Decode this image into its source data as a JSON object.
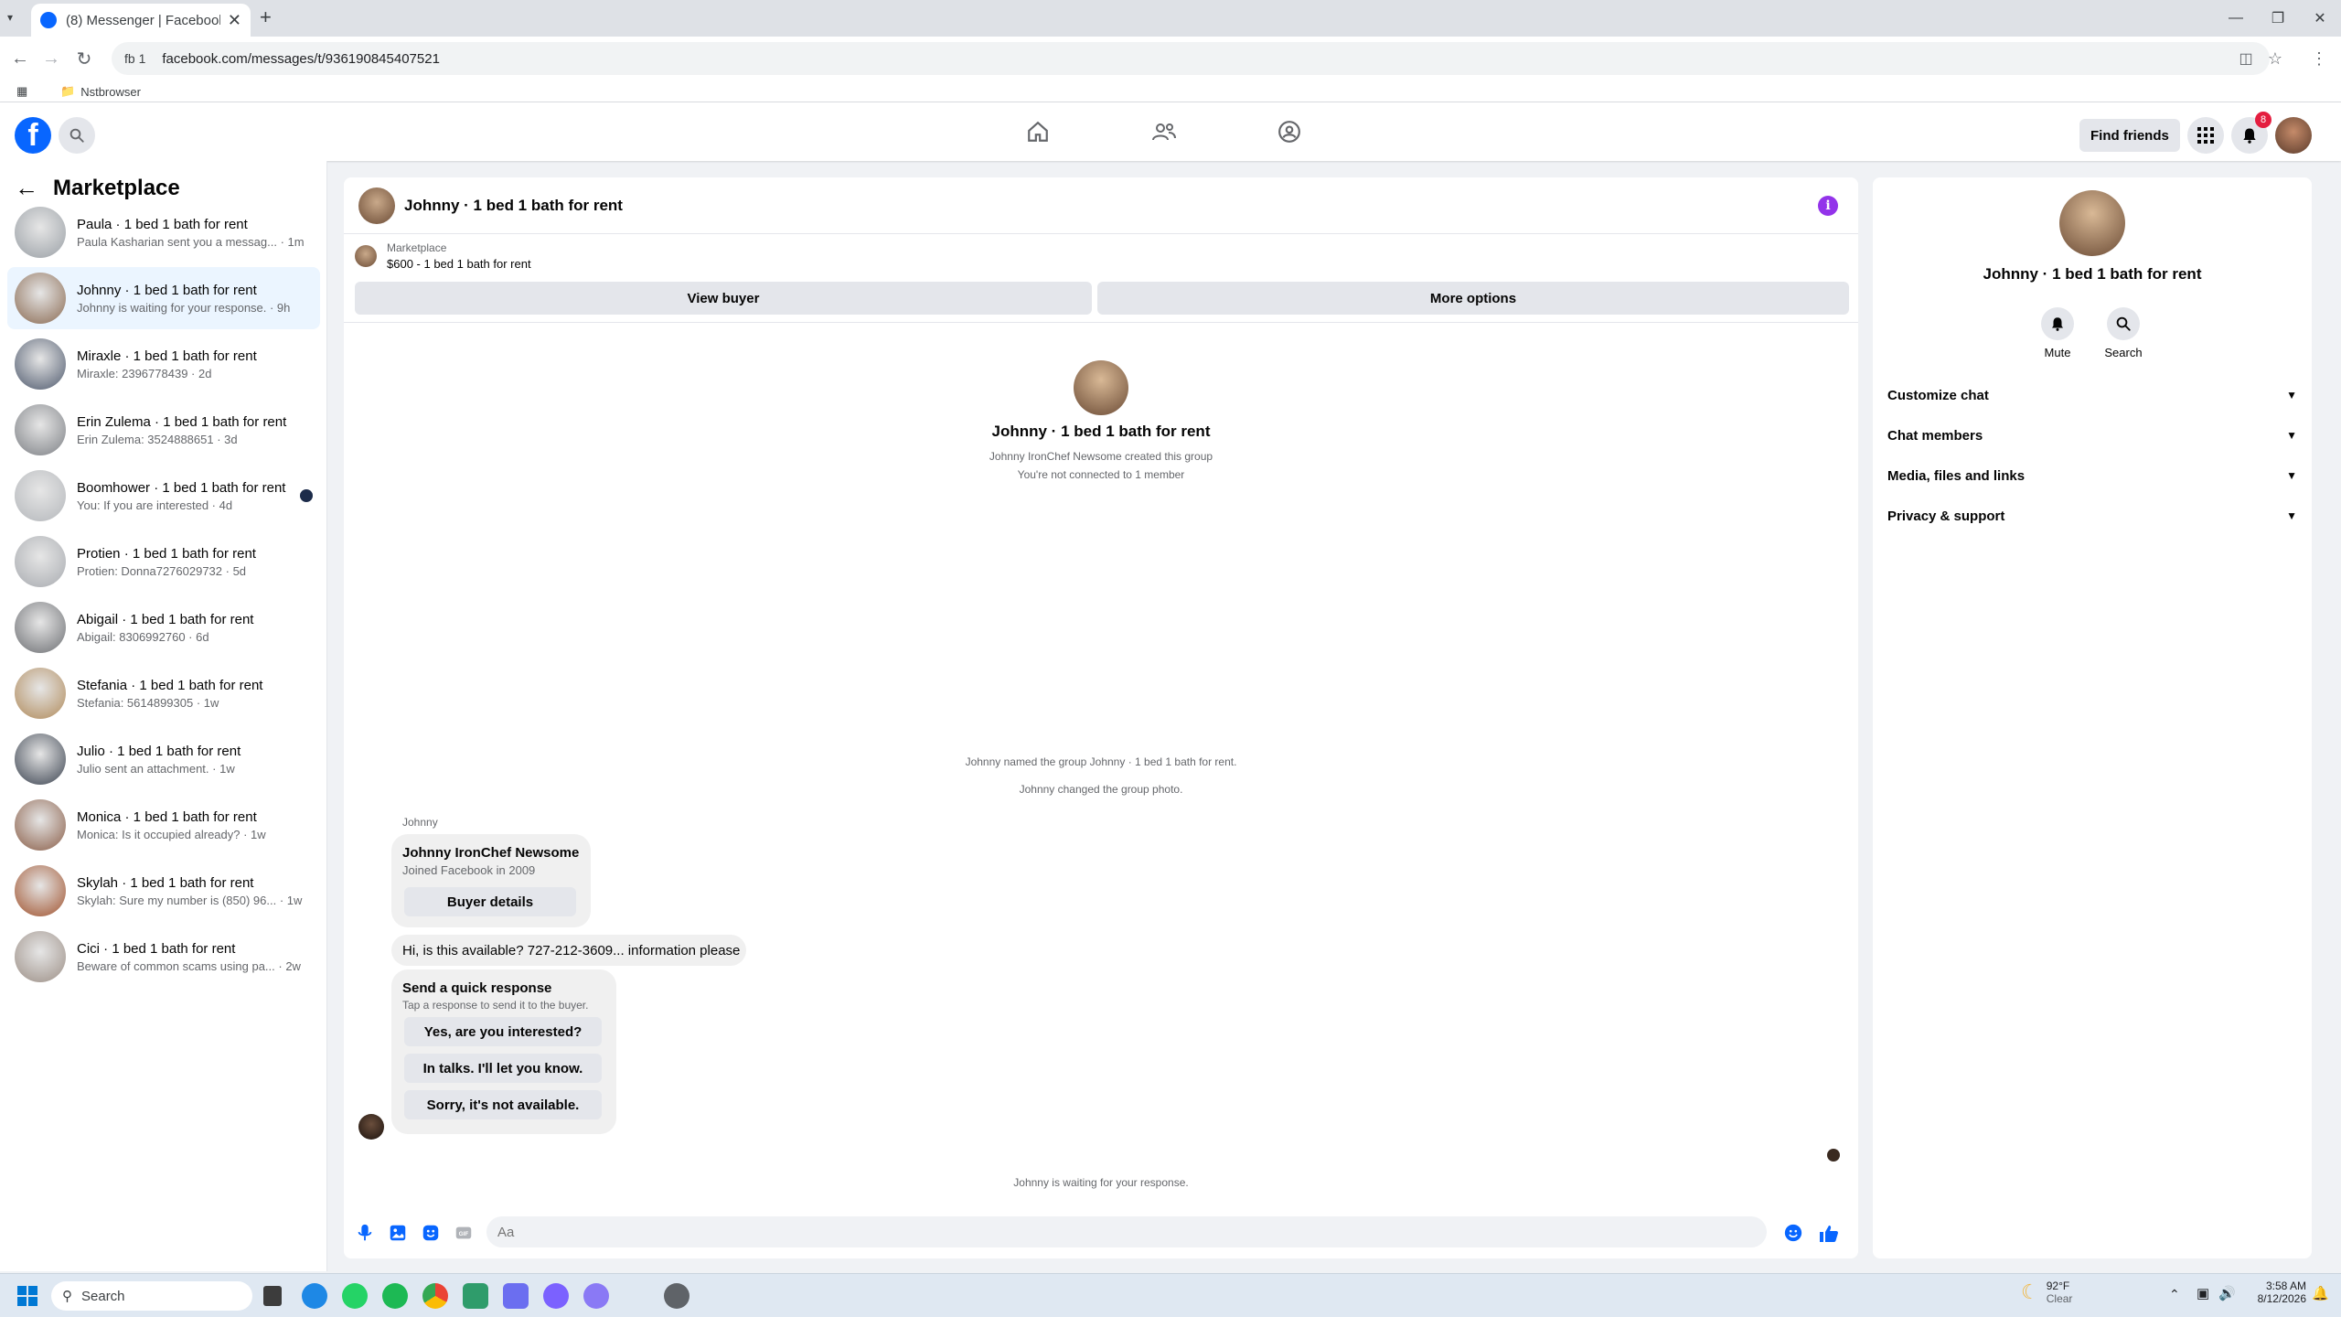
{
  "browser": {
    "tab_title": "(8) Messenger | Facebook",
    "profile_chip": "fb 1",
    "url": "facebook.com/messages/t/936190845407521",
    "bookmark_folder": "Nstbrowser"
  },
  "header": {
    "find_friends": "Find friends",
    "notification_count": "8"
  },
  "sidebar": {
    "title": "Marketplace",
    "conversations": [
      {
        "name": "Paula · 1 bed 1 bath for rent",
        "preview": "Paula Kasharian sent you a messag... · 1m",
        "color": "#9aa0a6"
      },
      {
        "name": "Johnny · 1 bed 1 bath for rent",
        "preview": "Johnny is waiting for your response. · 9h",
        "color": "#8a6a52"
      },
      {
        "name": "Miraxle · 1 bed 1 bath for rent",
        "preview": "Miraxle: 2396778439 · 2d",
        "color": "#4f5a6e"
      },
      {
        "name": "Erin Zulema · 1 bed 1 bath for rent",
        "preview": "Erin Zulema: 3524888651 · 3d",
        "color": "#7d8085"
      },
      {
        "name": "Boomhower · 1 bed 1 bath for rent",
        "preview": "You: If you are interested · 4d",
        "color": "#b4b7bb"
      },
      {
        "name": "Protien · 1 bed 1 bath for rent",
        "preview": "Protien: Donna7276029732 · 5d",
        "color": "#a8abb0"
      },
      {
        "name": "Abigail · 1 bed 1 bath for rent",
        "preview": "Abigail: 8306992760 · 6d",
        "color": "#6d6f73"
      },
      {
        "name": "Stefania · 1 bed 1 bath for rent",
        "preview": "Stefania: 5614899305 · 1w",
        "color": "#b08a5a"
      },
      {
        "name": "Julio · 1 bed 1 bath for rent",
        "preview": "Julio sent an attachment. · 1w",
        "color": "#3b4350"
      },
      {
        "name": "Monica · 1 bed 1 bath for rent",
        "preview": "Monica: Is it occupied already? · 1w",
        "color": "#8a5e48"
      },
      {
        "name": "Skylah · 1 bed 1 bath for rent",
        "preview": "Skylah: Sure my number is (850) 96... · 1w",
        "color": "#a0522d"
      },
      {
        "name": "Cici · 1 bed 1 bath for rent",
        "preview": "Beware of common scams using pa... · 2w",
        "color": "#9c8f86"
      }
    ]
  },
  "chat": {
    "title": "Johnny · 1 bed 1 bath for rent",
    "marketplace_label": "Marketplace",
    "listing": "$600 - 1 bed 1 bath for rent",
    "view_buyer": "View buyer",
    "more_options": "More options",
    "group_title": "Johnny · 1 bed 1 bath for rent",
    "created_by": "Johnny IronChef Newsome created this group",
    "not_connected": "You're not connected to 1 member",
    "named_group": "Johnny named the group Johnny · 1 bed 1 bath for rent.",
    "changed_photo": "Johnny changed the group photo.",
    "sender": "Johnny",
    "buyer_name": "Johnny IronChef Newsome",
    "buyer_joined": "Joined Facebook in 2009",
    "buyer_details": "Buyer details",
    "message": "Hi, is this available? 727-212-3609... information please",
    "quick_title": "Send a quick response",
    "quick_sub": "Tap a response to send it to the buyer.",
    "quick_1": "Yes, are you interested?",
    "quick_2": "In talks. I'll let you know.",
    "quick_3": "Sorry, it's not available.",
    "waiting": "Johnny is waiting for your response.",
    "composer_placeholder": "Aa"
  },
  "rpanel": {
    "title": "Johnny · 1 bed 1 bath for rent",
    "mute": "Mute",
    "search": "Search",
    "sections": [
      "Customize chat",
      "Chat members",
      "Media, files and links",
      "Privacy & support"
    ]
  },
  "taskbar": {
    "search": "Search",
    "temp": "92°F",
    "weather": "Clear",
    "time": "3:58 AM",
    "date": "8/12/2026"
  },
  "colors": {
    "accent": "#0866ff",
    "info": "#9333ea",
    "badge": "#e41e3f"
  }
}
